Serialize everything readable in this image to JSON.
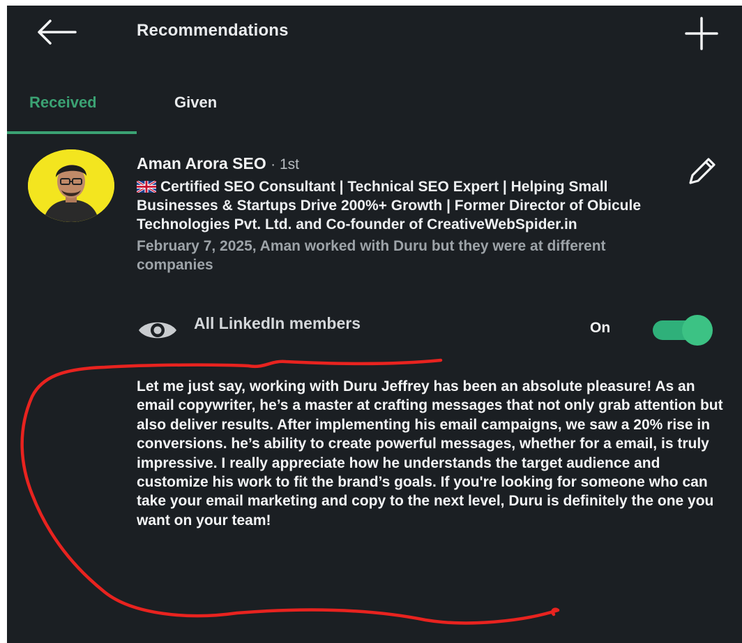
{
  "header": {
    "title": "Recommendations"
  },
  "tabs": [
    {
      "label": "Received",
      "active": true
    },
    {
      "label": "Given",
      "active": false
    }
  ],
  "recommendation": {
    "author_name": "Aman Arora SEO",
    "connection_degree": "· 1st",
    "headline": "Certified SEO Consultant | Technical SEO Expert | Helping Small Businesses & Startups Drive 200%+ Growth | Former Director of Obicule Technologies Pvt. Ltd. and Co-founder of CreativeWebSpider.in",
    "relationship": "February 7, 2025, Aman worked with Duru but they were at different companies",
    "visibility_label": "All LinkedIn members",
    "toggle_state_label": "On",
    "text": "Let me just say, working with Duru Jeffrey has been an absolute pleasure! As an email copywriter, he’s a master at crafting messages that not only grab attention but also deliver results. After implementing his email campaigns, we saw a 20% rise in conversions. he’s ability to create powerful messages, whether for a email, is truly impressive. I really appreciate how he understands the target audience and customize his work to fit the brand’s goals. If you're looking for someone who can take your email marketing and copy to the next level, Duru is definitely the one you want on your team!"
  },
  "icons": {
    "back": "back-arrow-icon",
    "add": "plus-icon",
    "edit": "pencil-icon",
    "visibility": "eye-icon",
    "flag": "uk-flag-icon"
  },
  "colors": {
    "background": "#1b1f23",
    "accent_green": "#3ba273",
    "toggle_green": "#2fb07a",
    "annotation_red": "#e8231f",
    "avatar_bg": "#f3e51f"
  }
}
